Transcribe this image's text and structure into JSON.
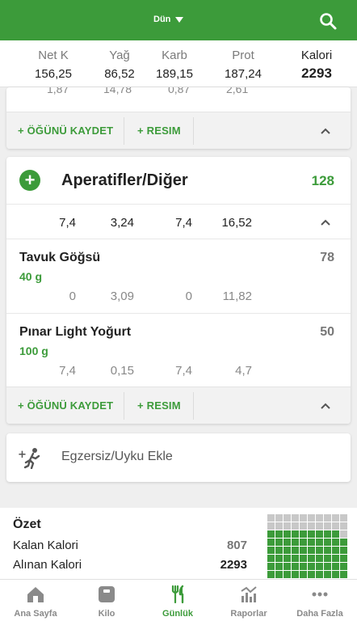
{
  "topbar": {
    "date_label": "Dün"
  },
  "macros": [
    {
      "label": "Net K",
      "value": "156,25"
    },
    {
      "label": "Yağ",
      "value": "86,52"
    },
    {
      "label": "Karb",
      "value": "189,15"
    },
    {
      "label": "Prot",
      "value": "187,24"
    },
    {
      "label": "Kalori",
      "value": "2293"
    }
  ],
  "prev_meal": {
    "partial_values": [
      "1,87",
      "14,78",
      "0,87",
      "2,61"
    ],
    "save_label": "+ ÖĞÜNÜ KAYDET",
    "photo_label": "+ RESIM"
  },
  "meal": {
    "add_symbol": "+",
    "title": "Aperatifler/Diğer",
    "calories": "128",
    "totals": [
      "7,4",
      "3,24",
      "7,4",
      "16,52"
    ],
    "foods": [
      {
        "name": "Tavuk Göğsü",
        "qty": "40 g",
        "cal": "78",
        "values": [
          "0",
          "3,09",
          "0",
          "11,82"
        ]
      },
      {
        "name": "Pınar Light Yoğurt",
        "qty": "100 g",
        "cal": "50",
        "values": [
          "7,4",
          "0,15",
          "7,4",
          "4,7"
        ]
      }
    ],
    "save_label": "+ ÖĞÜNÜ KAYDET",
    "photo_label": "+ RESIM"
  },
  "exercise": {
    "label": "Egzersiz/Uyku Ekle"
  },
  "summary": {
    "title": "Özet",
    "remaining_label": "Kalan Kalori",
    "remaining_value": "807",
    "eaten_label": "Alınan Kalori",
    "eaten_value": "2293",
    "grid_fill_fraction": 0.74
  },
  "tabs": [
    {
      "label": "Ana Sayfa",
      "icon": "home-icon",
      "active": false
    },
    {
      "label": "Kilo",
      "icon": "scale-icon",
      "active": false
    },
    {
      "label": "Günlük",
      "icon": "utensils-icon",
      "active": true
    },
    {
      "label": "Raporlar",
      "icon": "chart-icon",
      "active": false
    },
    {
      "label": "Daha Fazla",
      "icon": "more-icon",
      "active": false
    }
  ],
  "colors": {
    "brand": "#3c9b3a",
    "grid_empty": "#c8c8c8"
  }
}
